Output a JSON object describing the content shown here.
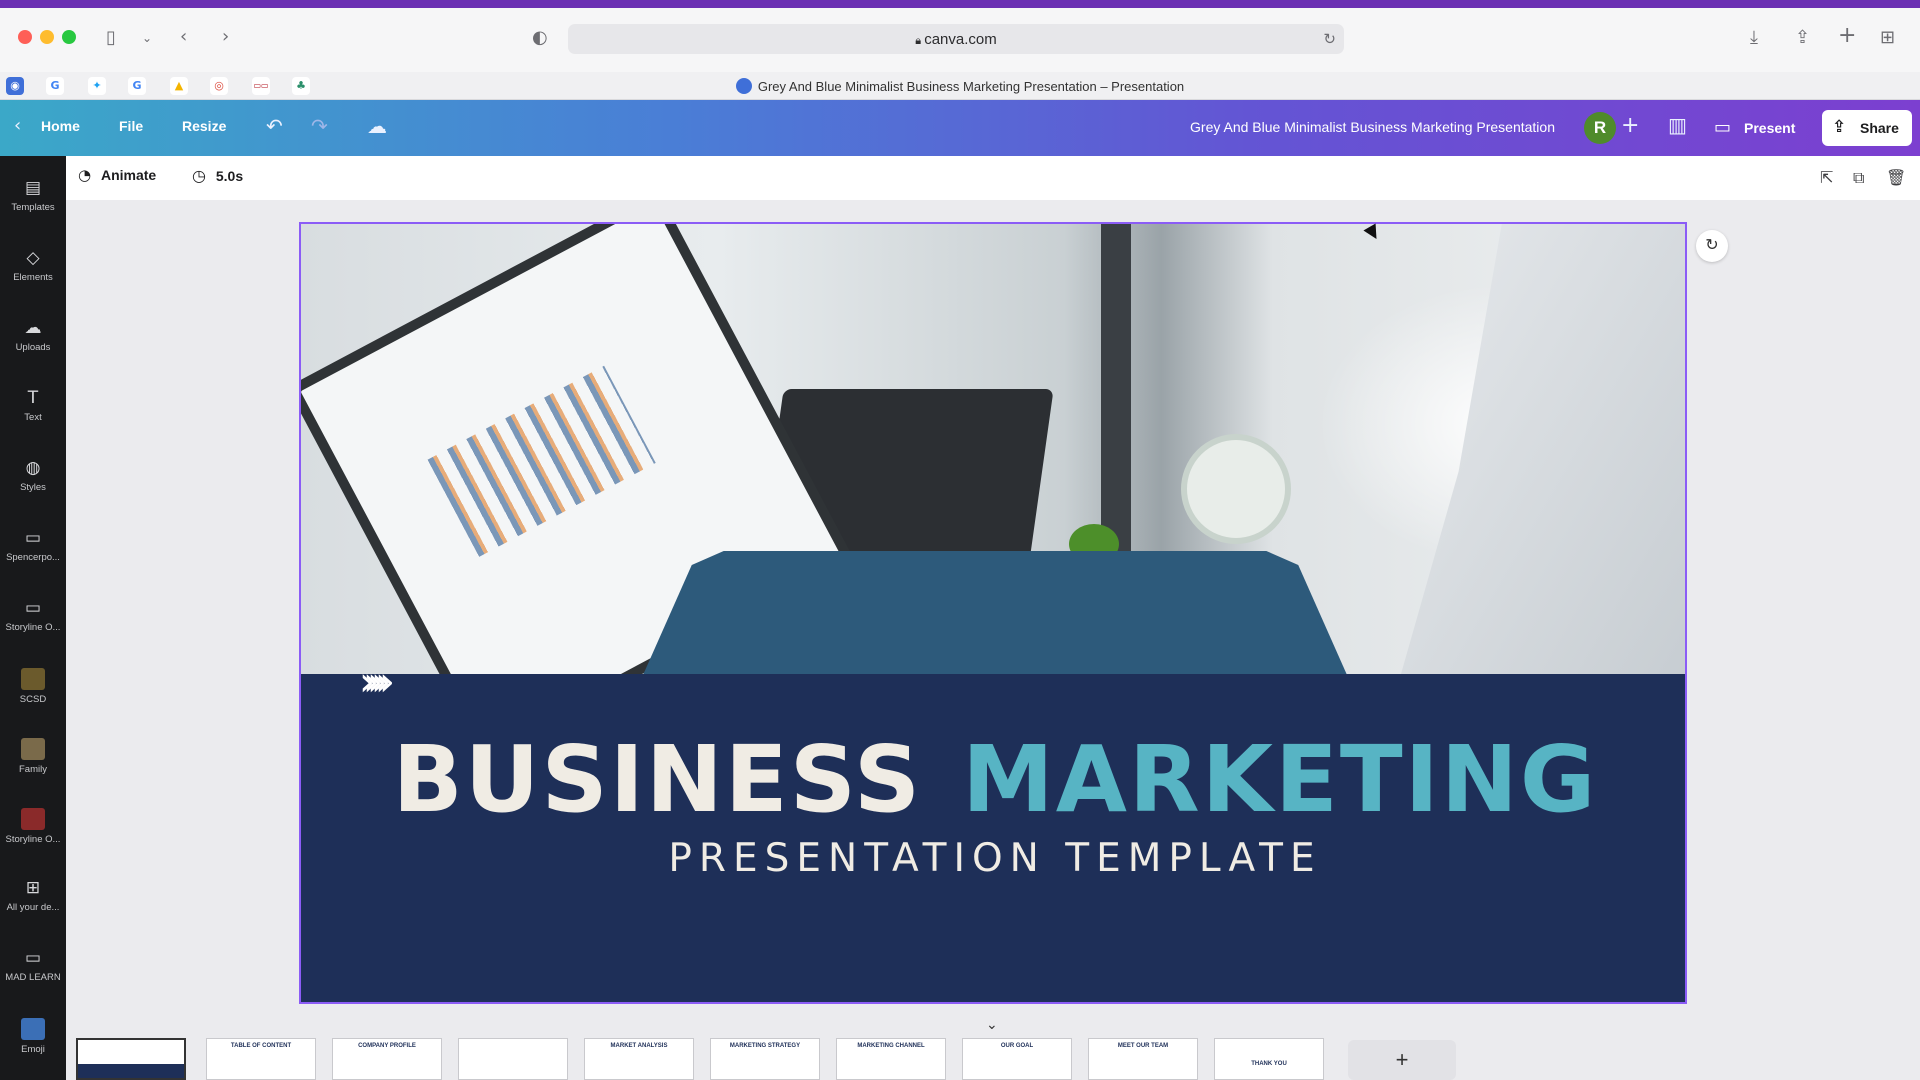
{
  "browser": {
    "url": "canva.com",
    "tab_title": "Grey And Blue Minimalist Business Marketing Presentation – Presentation"
  },
  "toolbar": {
    "home_label": "Home",
    "file_label": "File",
    "resize_label": "Resize",
    "doc_title": "Grey And Blue Minimalist  Business Marketing Presentation",
    "avatar_initial": "R",
    "present_label": "Present",
    "share_label": "Share"
  },
  "rail": {
    "items": [
      {
        "label": "Templates",
        "icon": "templates-icon"
      },
      {
        "label": "Elements",
        "icon": "elements-icon"
      },
      {
        "label": "Uploads",
        "icon": "uploads-icon"
      },
      {
        "label": "Text",
        "icon": "text-icon"
      },
      {
        "label": "Styles",
        "icon": "styles-icon"
      },
      {
        "label": "Spencerpo...",
        "icon": "folder-icon"
      },
      {
        "label": "Storyline O...",
        "icon": "folder-icon"
      },
      {
        "label": "SCSD",
        "icon": "scsd-thumbnail"
      },
      {
        "label": "Family",
        "icon": "family-thumbnail"
      },
      {
        "label": "Storyline O...",
        "icon": "storyline-thumbnail"
      },
      {
        "label": "All your de...",
        "icon": "grid-icon"
      },
      {
        "label": "MAD LEARN",
        "icon": "folder-icon"
      },
      {
        "label": "Emoji",
        "icon": "emoji-icon"
      }
    ]
  },
  "editor": {
    "animate_label": "Animate",
    "duration_label": "5.0s"
  },
  "slide": {
    "headline_word1": "BUSINESS",
    "headline_word2": "MARKETING",
    "subtitle": "PRESENTATION TEMPLATE"
  },
  "filmstrip": {
    "thumbs": [
      {
        "label": ""
      },
      {
        "label": "TABLE OF CONTENT"
      },
      {
        "label": "COMPANY PROFILE"
      },
      {
        "label": ""
      },
      {
        "label": "MARKET ANALYSIS"
      },
      {
        "label": "MARKETING STRATEGY"
      },
      {
        "label": "MARKETING CHANNEL"
      },
      {
        "label": "OUR GOAL"
      },
      {
        "label": "MEET OUR TEAM"
      },
      {
        "label": "THANK YOU"
      }
    ],
    "add_label": "+"
  },
  "colors": {
    "banner": "#1e2f58",
    "accent_teal": "#57b4c4",
    "tab_shape": "#2d5a7b",
    "selection": "#8b5cf6"
  }
}
